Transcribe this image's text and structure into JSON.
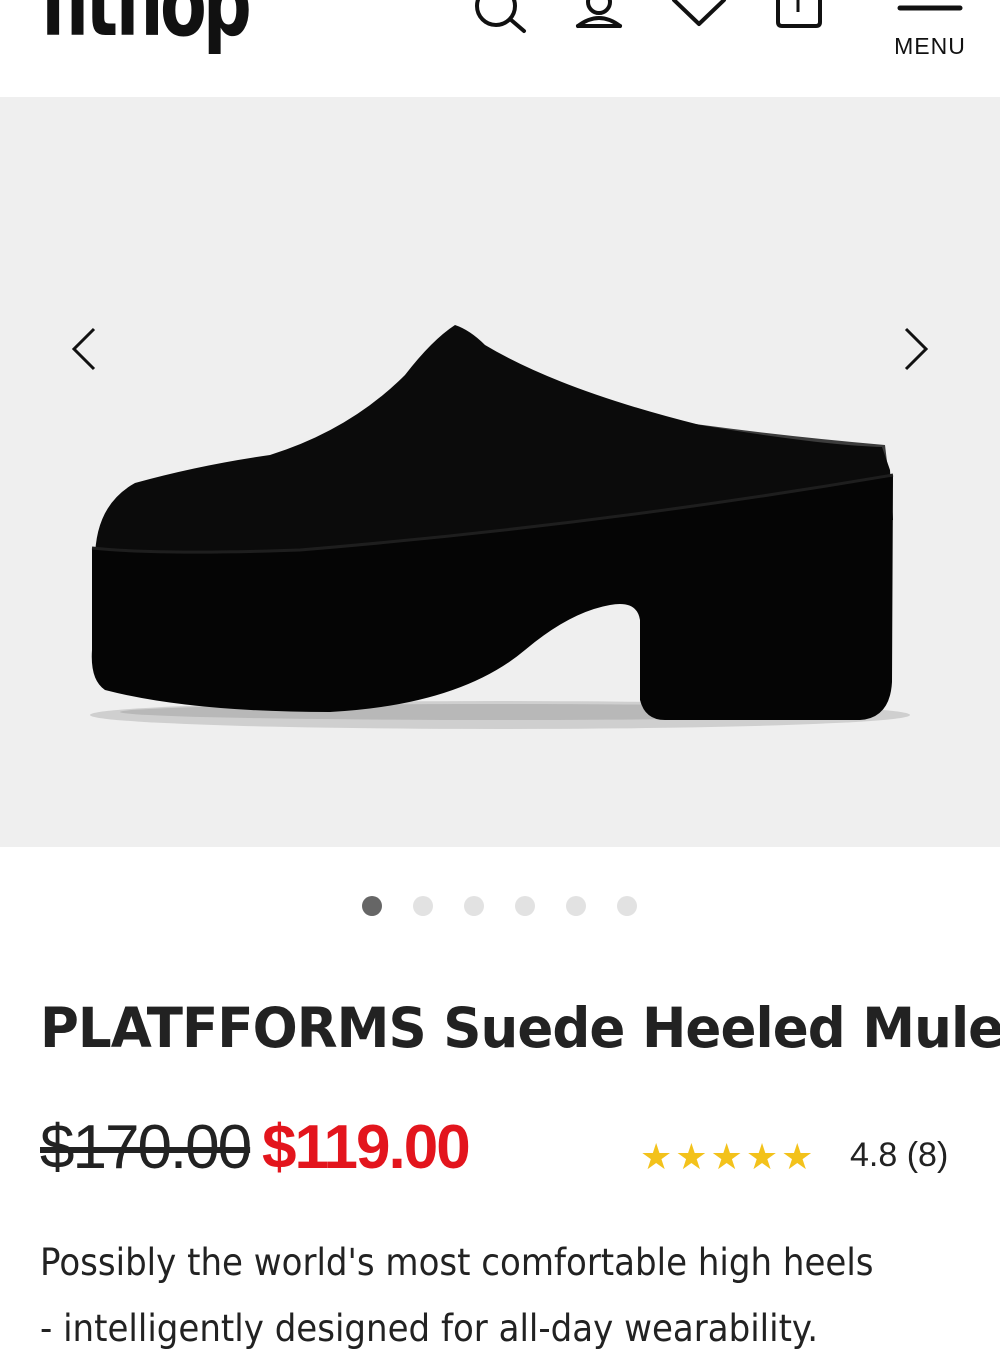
{
  "header": {
    "logo_text": "fitflop",
    "menu_label": "MENU",
    "icons": [
      "search-icon",
      "account-icon",
      "wishlist-heart-icon",
      "shopping-bag-icon",
      "hamburger-menu-icon"
    ]
  },
  "gallery": {
    "image_alt": "black suede platform heeled mule shoe",
    "prev_icon": "chevron-left-icon",
    "next_icon": "chevron-right-icon",
    "slide_count": 6,
    "active_slide": 1
  },
  "product": {
    "title": "PLATFFORMS Suede Heeled Mules",
    "original_price": "$170.00",
    "sale_price": "$119.00",
    "stars": "★★★★★",
    "rating_text": "4.8 (8)",
    "description": "Possibly the world's most comfortable high heels - intelligently designed for all-day wearability."
  },
  "colors": {
    "sale": "#e3151d",
    "star": "#f3c21b",
    "text": "#222222",
    "gallery_bg": "#efefef",
    "dot_active": "#666666",
    "dot_inactive": "#e2e2e2"
  }
}
